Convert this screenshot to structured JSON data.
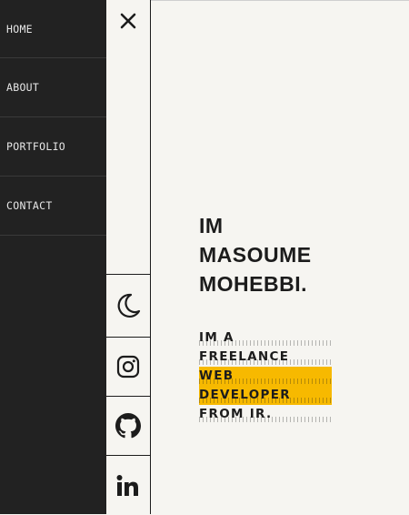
{
  "nav": {
    "items": [
      {
        "label": "HOME"
      },
      {
        "label": "ABOUT"
      },
      {
        "label": "PORTFOLIO"
      },
      {
        "label": "CONTACT"
      }
    ]
  },
  "icons": {
    "close": "close-icon",
    "theme": "moon-icon",
    "instagram": "instagram-icon",
    "github": "github-icon",
    "linkedin": "linkedin-icon"
  },
  "hero": {
    "name_lines": [
      "IM",
      "MASOUME",
      "MOHEBBI."
    ],
    "tagline_lines": [
      "IM A",
      "FREELANCE",
      "WEB",
      "DEVELOPER",
      "FROM IR."
    ]
  },
  "colors": {
    "nav_bg": "#222222",
    "page_bg": "#f6f5f1",
    "highlight": "#f7b900",
    "text": "#1c1c1c"
  }
}
